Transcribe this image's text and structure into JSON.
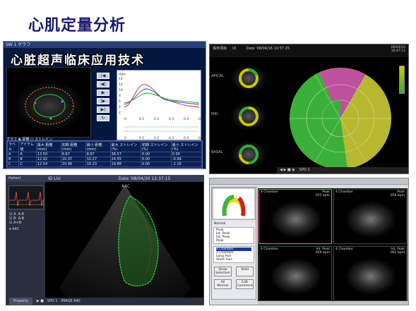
{
  "slide": {
    "title": "心肌定量分析"
  },
  "panel_a": {
    "window_title": "SW 1 ゲラフ",
    "overlay_text": "心脏超声临床应用技术",
    "graph_unit": "mm",
    "graph_y_ticks": [
      "14",
      "12",
      "10",
      "8",
      "6",
      "4",
      "2"
    ],
    "graph_x_ticks": [
      "0",
      "0.1",
      "0.2",
      "0.3",
      "0.4",
      "0.5"
    ],
    "graph_x_ticks_lower": [
      "0",
      "0.1",
      "0.2",
      "0.3",
      "0.4",
      "0.5"
    ],
    "options": [
      "グラフ",
      "距離",
      "ストレイン"
    ],
    "table_headers": [
      "ラベル",
      "アイテム値",
      "最大 距離(mm)",
      "初期 距離(mm)",
      "最小 距離(mm)",
      "最大 ストレイン(%)",
      "初期 ストレイン(%)",
      "最小 ストレイン(%)"
    ],
    "table_rows": [
      [
        "A",
        "A",
        "13.50",
        "8.67",
        "8.67",
        "38.57",
        "0.00",
        "0.00"
      ],
      [
        "B",
        "B",
        "12.92",
        "10.37",
        "10.27",
        "24.55",
        "0.00",
        "-0.99"
      ],
      [
        "C",
        "C",
        "12.54",
        "10.46",
        "10.23",
        "19.88",
        "0.00",
        "-2.16"
      ]
    ]
  },
  "panel_b": {
    "header_left": "保存項目",
    "header_id": "ID",
    "header_date": "Date  '08/04/16  10:57:25",
    "top_right": "06/04/16\n16:47:12",
    "thumb_labels": [
      "APICAL",
      "MID",
      "BASAL"
    ],
    "footer": "SPD  1"
  },
  "panel_c": {
    "patient_label": "Patient",
    "id_label": "ID  LIU",
    "date_label": "Date  '08/04/20  12:37:15",
    "legend": [
      "A",
      "A-B",
      "B",
      "A-B",
      "A+B"
    ],
    "view_label": "A4C",
    "property_button": "Property",
    "spd_label": "SPD",
    "spd_value": "1",
    "image_label": "IMAGE",
    "image_value": "A4C"
  },
  "panel_d": {
    "list_group1": [
      "Peak",
      "Int. Peak",
      "Int. Peak",
      "Peak"
    ],
    "list_group2": [
      "4 Chamber",
      "2 Chamber",
      "Long Axis",
      "Short Axis"
    ],
    "buttons": [
      "Show Selection",
      "Valid",
      "All Normal",
      "Edit Comment"
    ],
    "normal_label": "Normal",
    "cells": [
      {
        "left": "4 Chamber",
        "right": "Peak\n055 bpm"
      },
      {
        "left": "4 Chamber",
        "right": "Peak\n056 bpm"
      },
      {
        "left": "4 Chamber",
        "right": "Int. Peak\n059 bpm"
      },
      {
        "left": "4 Chamber",
        "right": "Int. Peak\n062 bpm"
      }
    ]
  }
}
